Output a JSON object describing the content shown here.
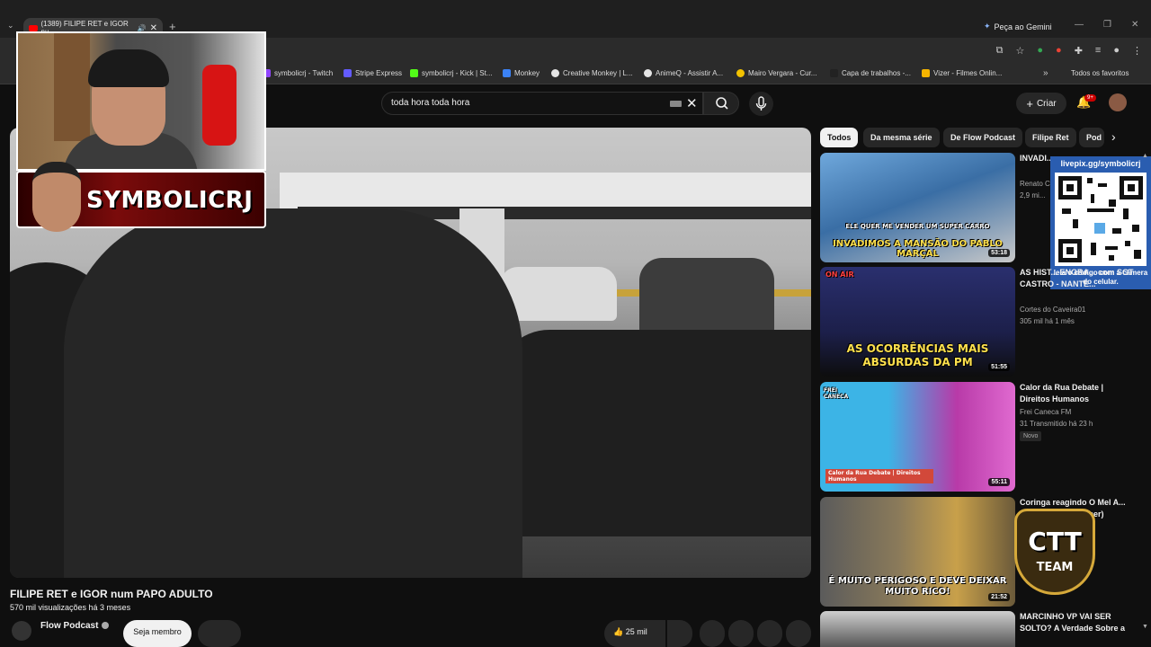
{
  "browser": {
    "tab_title": "(1389) FILIPE RET e IGOR nu",
    "gemini_label": "Peça ao Gemini",
    "bookmarks": [
      {
        "label": "symbolicrj - Twitch",
        "color": "#9146ff"
      },
      {
        "label": "Stripe Express",
        "color": "#635bff"
      },
      {
        "label": "symbolicrj - Kick | St...",
        "color": "#53fc18"
      },
      {
        "label": "Monkey",
        "color": "#3b82f6"
      },
      {
        "label": "Creative Monkey | L...",
        "color": "#e5e5e5"
      },
      {
        "label": "AnimeQ - Assistir A...",
        "color": "#e5e5e5"
      },
      {
        "label": "Mairo Vergara - Cur...",
        "color": "#f2c200"
      },
      {
        "label": "Capa de trabalhos -...",
        "color": "#222222"
      },
      {
        "label": "Vizer - Filmes Onlin...",
        "color": "#f5b400"
      }
    ],
    "favorites_label": "Todos os favoritos"
  },
  "youtube": {
    "search_query": "toda hora toda hora",
    "create_label": "Criar",
    "notifications_count": "9+"
  },
  "video": {
    "title": "FILIPE RET e IGOR num PAPO ADULTO",
    "views_line": "570 mil visualizações  há 3 meses",
    "channel": "Flow Podcast",
    "join_label": "Seja membro",
    "likes": "25 mil"
  },
  "overlays": {
    "streamer_name": "SYMBOLICRJ",
    "qr_url": "livepix.gg/symbolicrj",
    "qr_caption": "leia o código com a câmera do celular.",
    "team_line1": "CTT",
    "team_line2": "TEAM"
  },
  "chips": [
    "Todos",
    "Da mesma série",
    "De Flow Podcast",
    "Filipe Ret",
    "Pod"
  ],
  "recommendations": [
    {
      "title": "INVADI... PABLO...",
      "channel": "Renato C...",
      "meta": "2,9 mi...",
      "duration": "53:18",
      "thumb_text": "INVADIMOS A MANSÃO DO PABLO MARÇAL",
      "thumb_top": "ELE QUER ME VENDER UM SUPER CARRO",
      "thumb_color": "#3a6ea5"
    },
    {
      "title": "AS HIST... ENGRA... com SGT CASTRO - NANTE...",
      "channel": "Cortes do Caveira01",
      "meta": "305 mil  há 1 mês",
      "duration": "51:55",
      "thumb_text": "AS OCORRÊNCIAS MAIS ABSURDAS DA PM",
      "thumb_top": "ON AIR",
      "thumb_color": "#1c1f4a"
    },
    {
      "title": "Calor da Rua Debate | Direitos Humanos",
      "channel": "Frei Caneca FM",
      "meta": "31  Transmitido há 23 h",
      "badge": "Novo",
      "duration": "55:11",
      "thumb_text": "Calor da Rua Debate | Direitos Humanos",
      "thumb_top": "FREI CANECA",
      "thumb_color": "#b83aa8"
    },
    {
      "title": "Coringa reagindo O Mel A... Nepal (Eles ... quecer)",
      "channel": "",
      "meta": "",
      "duration": "21:52",
      "thumb_text": "É MUITO PERIGOSO E DEVE DEIXAR MUITO RICO!",
      "thumb_top": "",
      "thumb_color": "#6b5a3a"
    },
    {
      "title": "MARCINHO VP VAI SER SOLTO? A Verdade Sobre a",
      "channel": "",
      "meta": "",
      "duration": "",
      "thumb_text": "",
      "thumb_top": "",
      "thumb_color": "#2e2e2e"
    }
  ]
}
